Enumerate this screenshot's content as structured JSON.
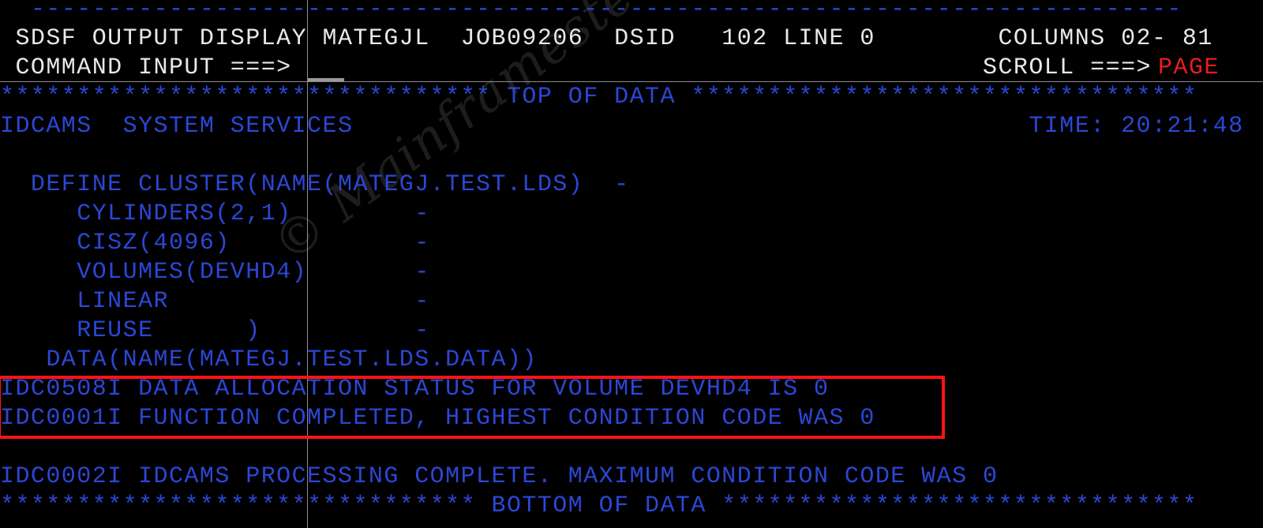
{
  "screen": {
    "title": "SDSF OUTPUT DISPLAY",
    "colors": {
      "background": "#000000",
      "text_blue": "#2b47d6",
      "text_white": "#e8e8e8",
      "accent_red": "#e81c1c",
      "highlight_box": "#ff1414",
      "separator": "#8c8c8c",
      "watermark": "#1d1d1d"
    }
  },
  "header": {
    "rule_line": "  ---------------------------------------------------------------------------",
    "title_line": " SDSF OUTPUT DISPLAY MATEGJL  JOB09206  DSID   102 LINE 0        COLUMNS 02- 81",
    "command_line": " COMMAND INPUT ===>                                             SCROLL ===> ",
    "program": "SDSF OUTPUT DISPLAY",
    "user": "MATEGJL",
    "job_id": "JOB09206",
    "dsid_label": "DSID",
    "dsid": "102",
    "line_label": "LINE",
    "line": "0",
    "columns_label": "COLUMNS",
    "columns": "02- 81",
    "command_label": "COMMAND INPUT ===>",
    "command_value": "",
    "scroll_label": "SCROLL ===>",
    "scroll_value": "PAGE"
  },
  "body": {
    "top_of_data": "******************************** TOP OF DATA *********************************",
    "bottom_of_data": "******************************* BOTTOM OF DATA *******************************",
    "lines": [
      {
        "text": "IDCAMS  SYSTEM SERVICES                                            TIME: 20:21:48",
        "color": "blue"
      },
      {
        "text": "",
        "color": "blue"
      },
      {
        "text": "  DEFINE CLUSTER(NAME(MATEGJ.TEST.LDS)  -",
        "color": "blue"
      },
      {
        "text": "     CYLINDERS(2,1)        -",
        "color": "blue"
      },
      {
        "text": "     CISZ(4096)            -",
        "color": "blue"
      },
      {
        "text": "     VOLUMES(DEVHD4)       -",
        "color": "blue"
      },
      {
        "text": "     LINEAR                -",
        "color": "blue"
      },
      {
        "text": "     REUSE      )          -",
        "color": "blue"
      },
      {
        "text": "   DATA(NAME(MATEGJ.TEST.LDS.DATA))",
        "color": "blue"
      },
      {
        "text": "IDC0508I DATA ALLOCATION STATUS FOR VOLUME DEVHD4 IS 0",
        "color": "blue"
      },
      {
        "text": "IDC0001I FUNCTION COMPLETED, HIGHEST CONDITION CODE WAS 0",
        "color": "blue"
      },
      {
        "text": "",
        "color": "blue"
      },
      {
        "text": "IDC0002I IDCAMS PROCESSING COMPLETE. MAXIMUM CONDITION CODE WAS 0",
        "color": "blue"
      }
    ],
    "idcams_banner": "IDCAMS  SYSTEM SERVICES",
    "time_label": "TIME:",
    "time_value": "20:21:48",
    "messages": {
      "idc0508i": "IDC0508I DATA ALLOCATION STATUS FOR VOLUME DEVHD4 IS 0",
      "idc0001i": "IDC0001I FUNCTION COMPLETED, HIGHEST CONDITION CODE WAS 0",
      "idc0002i": "IDC0002I IDCAMS PROCESSING COMPLETE. MAXIMUM CONDITION CODE WAS 0"
    },
    "idcams_command": {
      "define": "  DEFINE CLUSTER(NAME(MATEGJ.TEST.LDS)  -",
      "cylinders": "     CYLINDERS(2,1)        -",
      "cisz": "     CISZ(4096)            -",
      "volumes": "     VOLUMES(DEVHD4)       -",
      "linear": "     LINEAR                -",
      "reuse": "     REUSE      )          -",
      "data": "   DATA(NAME(MATEGJ.TEST.LDS.DATA))"
    }
  },
  "watermark": {
    "text": "© Mainframestechhelp"
  }
}
